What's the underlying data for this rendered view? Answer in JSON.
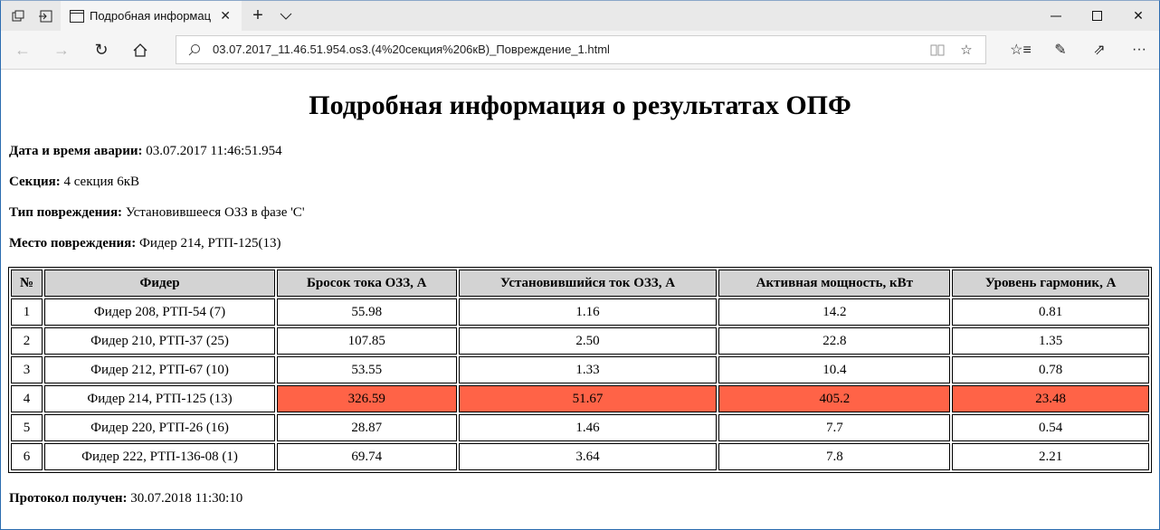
{
  "browser": {
    "tab_title": "Подробная информац",
    "url": "03.07.2017_11.46.51.954.os3.(4%20секция%206кВ)_Повреждение_1.html"
  },
  "page": {
    "title": "Подробная информация о результатах ОПФ",
    "info": [
      {
        "label": "Дата и время аварии:",
        "value": "03.07.2017 11:46:51.954"
      },
      {
        "label": "Секция:",
        "value": "4 секция 6кВ"
      },
      {
        "label": "Тип повреждения:",
        "value": "Установившееся ОЗЗ в фазе 'C'"
      },
      {
        "label": "Место повреждения:",
        "value": "Фидер 214, РТП-125(13)"
      }
    ],
    "table": {
      "headers": [
        "№",
        "Фидер",
        "Бросок тока ОЗЗ, А",
        "Установившийся ток ОЗЗ, А",
        "Активная мощность, кВт",
        "Уровень гармоник, А"
      ],
      "rows": [
        [
          "1",
          "Фидер 208, РТП-54 (7)",
          "55.98",
          "1.16",
          "14.2",
          "0.81"
        ],
        [
          "2",
          "Фидер 210, РТП-37 (25)",
          "107.85",
          "2.50",
          "22.8",
          "1.35"
        ],
        [
          "3",
          "Фидер 212, РТП-67 (10)",
          "53.55",
          "1.33",
          "10.4",
          "0.78"
        ],
        [
          "4",
          "Фидер 214, РТП-125 (13)",
          "326.59",
          "51.67",
          "405.2",
          "23.48"
        ],
        [
          "5",
          "Фидер 220, РТП-26 (16)",
          "28.87",
          "1.46",
          "7.7",
          "0.54"
        ],
        [
          "6",
          "Фидер 222, РТП-136-08 (1)",
          "69.74",
          "3.64",
          "7.8",
          "2.21"
        ]
      ],
      "highlight_row": 3,
      "highlight_color": "#ff6347"
    },
    "footer": {
      "label": "Протокол получен:",
      "value": "30.07.2018 11:30:10"
    }
  }
}
